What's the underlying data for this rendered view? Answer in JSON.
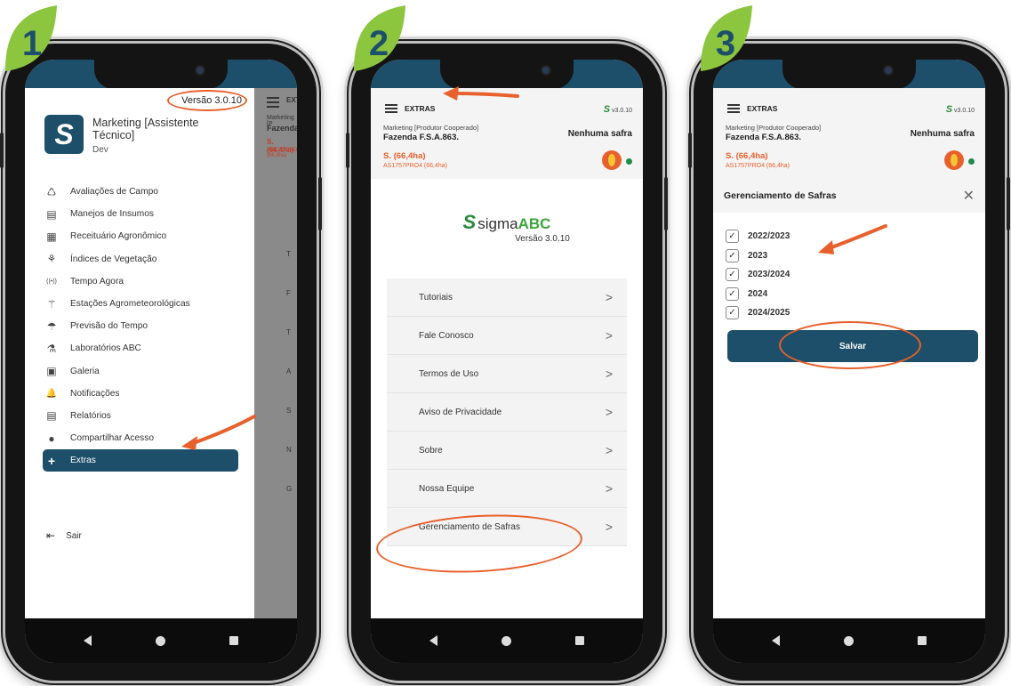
{
  "steps": [
    "1",
    "2",
    "3"
  ],
  "colors": {
    "primary": "#1d4f6a",
    "accent": "#e8602c",
    "badge": "#8cc63f",
    "brand_green": "#3aa63a"
  },
  "screen1": {
    "version": "Versão 3.0.10",
    "user_name": "Marketing [Assistente Técnico]",
    "user_role": "Dev",
    "peek_title": "EXTR",
    "peek_line1": "Marketing [P",
    "peek_line2": "Fazenda",
    "peek_letters": [
      "T",
      "F",
      "T",
      "A",
      "S",
      "N",
      "G"
    ],
    "menu": [
      {
        "label": "Avaliações de Campo",
        "icon": "field-evaluation-icon",
        "glyph": "♺"
      },
      {
        "label": "Manejos de Insumos",
        "icon": "inputs-icon",
        "glyph": "▤"
      },
      {
        "label": "Receituário Agronômico",
        "icon": "prescription-icon",
        "glyph": "▦"
      },
      {
        "label": "Índices de Vegetação",
        "icon": "vegetation-icon",
        "glyph": "⚘"
      },
      {
        "label": "Tempo Agora",
        "icon": "signal-icon",
        "glyph": "((•))"
      },
      {
        "label": "Estações Agrometeorológicas",
        "icon": "station-icon",
        "glyph": "⚚"
      },
      {
        "label": "Previsão do Tempo",
        "icon": "weather-icon",
        "glyph": "☂"
      },
      {
        "label": "Laboratórios ABC",
        "icon": "lab-icon",
        "glyph": "⚗"
      },
      {
        "label": "Galeria",
        "icon": "gallery-icon",
        "glyph": "▣"
      },
      {
        "label": "Notificações",
        "icon": "bell-icon",
        "glyph": "🔔"
      },
      {
        "label": "Relatórios",
        "icon": "report-icon",
        "glyph": "▤"
      },
      {
        "label": "Compartilhar Acesso",
        "icon": "person-icon",
        "glyph": "●"
      },
      {
        "label": "Extras",
        "icon": "plus-icon",
        "glyph": "+"
      }
    ],
    "logout": "Sair"
  },
  "header": {
    "title": "EXTRAS",
    "version": "v3.0.10",
    "producer": "Marketing [Produtor Cooperado]",
    "farm": "Fazenda F.S.A.863.",
    "safra": "Nenhuma safra",
    "area": "S. (66,4ha)",
    "area_sub": "AS1757PRO4 (66,4ha)"
  },
  "screen2": {
    "brand_plain": "sigma",
    "brand_bold": "ABC",
    "version": "Versão 3.0.10",
    "items": [
      "Tutoriais",
      "Fale Conosco",
      "Termos de Uso",
      "Aviso de Privacidade",
      "Sobre",
      "Nossa Equipe",
      "Gerenciamento de Safras"
    ]
  },
  "screen3": {
    "title": "Gerenciamento de Safras",
    "seasons": [
      "2022/2023",
      "2023",
      "2023/2024",
      "2024",
      "2024/2025"
    ],
    "save": "Salvar"
  }
}
